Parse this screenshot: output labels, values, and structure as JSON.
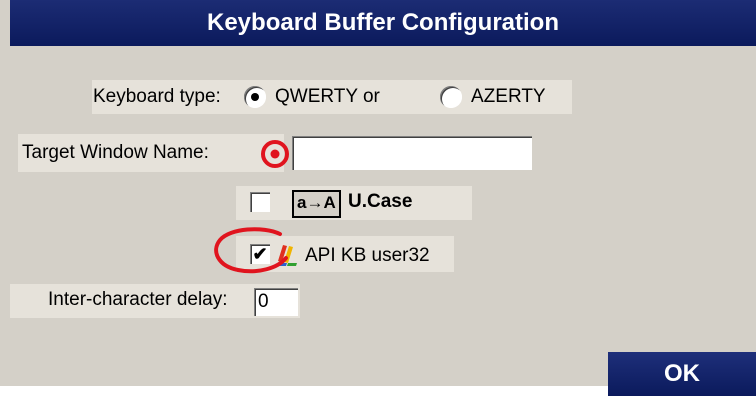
{
  "dialog": {
    "title": "Keyboard Buffer Configuration",
    "keyboard_type_label": "Keyboard type:",
    "qwerty_option": "QWERTY or",
    "azerty_option": "AZERTY",
    "selected_keyboard": "QWERTY",
    "target_window_label": "Target Window Name:",
    "target_window_value": "",
    "ucase_icon_text": "a→A",
    "ucase_label": "U.Case",
    "ucase_checked": false,
    "api_kb_label": "API KB user32",
    "api_kb_checked": true,
    "api_kb_check_mark": "✔",
    "delay_label": "Inter-character delay:",
    "delay_value": "0",
    "ok_label": "OK"
  },
  "colors": {
    "title_bar": "#0b1a5c",
    "dialog_bg": "#d4d0c8",
    "highlight_ring": "#e0141e"
  }
}
